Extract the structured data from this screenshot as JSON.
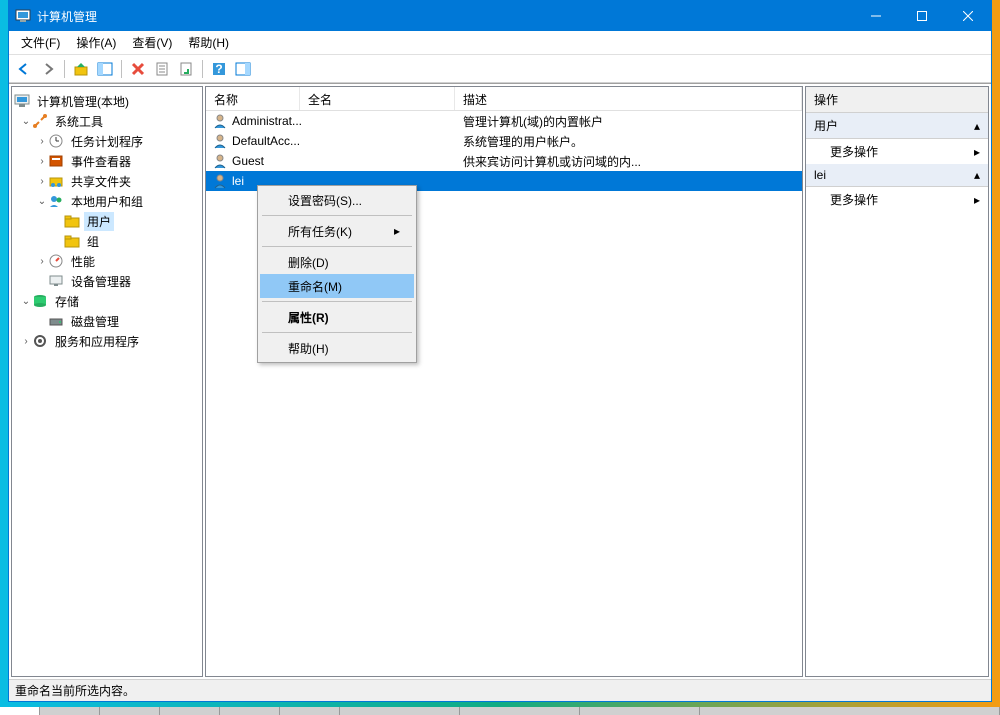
{
  "window_title": "计算机管理",
  "menubar": [
    "文件(F)",
    "操作(A)",
    "查看(V)",
    "帮助(H)"
  ],
  "tree": {
    "root": "计算机管理(本地)",
    "system_tools": "系统工具",
    "task_scheduler": "任务计划程序",
    "event_viewer": "事件查看器",
    "shared_folders": "共享文件夹",
    "local_users_groups": "本地用户和组",
    "users": "用户",
    "groups": "组",
    "performance": "性能",
    "device_manager": "设备管理器",
    "storage": "存储",
    "disk_management": "磁盘管理",
    "services_apps": "服务和应用程序"
  },
  "list": {
    "columns": {
      "name": "名称",
      "fullname": "全名",
      "description": "描述"
    },
    "rows": [
      {
        "name": "Administrat...",
        "fullname": "",
        "description": "管理计算机(域)的内置帐户"
      },
      {
        "name": "DefaultAcc...",
        "fullname": "",
        "description": "系统管理的用户帐户。"
      },
      {
        "name": "Guest",
        "fullname": "",
        "description": "供来宾访问计算机或访问域的内..."
      },
      {
        "name": "lei",
        "fullname": "",
        "description": ""
      }
    ],
    "selected_index": 3
  },
  "actions": {
    "header": "操作",
    "group1": "用户",
    "group2": "lei",
    "more": "更多操作"
  },
  "context_menu": {
    "set_password": "设置密码(S)...",
    "all_tasks": "所有任务(K)",
    "delete": "删除(D)",
    "rename": "重命名(M)",
    "properties": "属性(R)",
    "help": "帮助(H)"
  },
  "statusbar": "重命名当前所选内容。"
}
